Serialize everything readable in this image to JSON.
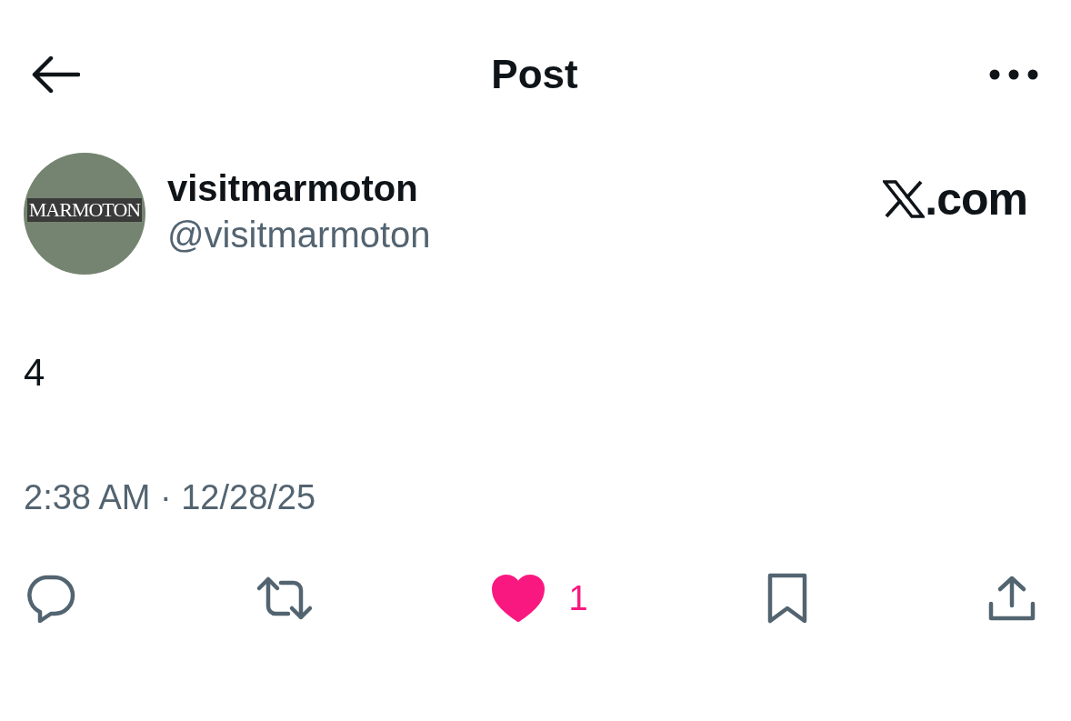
{
  "header": {
    "title": "Post"
  },
  "author": {
    "name": "visitmarmoton",
    "handle": "@visitmarmoton",
    "avatar_text": "MARMOTON"
  },
  "site": {
    "label": ".com"
  },
  "post": {
    "text": "4",
    "timestamp": "2:38 AM · 12/28/25"
  },
  "actions": [
    {
      "kind": "reply"
    },
    {
      "kind": "repost"
    },
    {
      "kind": "like",
      "selected": true,
      "count": "1"
    },
    {
      "kind": "bookmark"
    },
    {
      "kind": "share"
    }
  ]
}
